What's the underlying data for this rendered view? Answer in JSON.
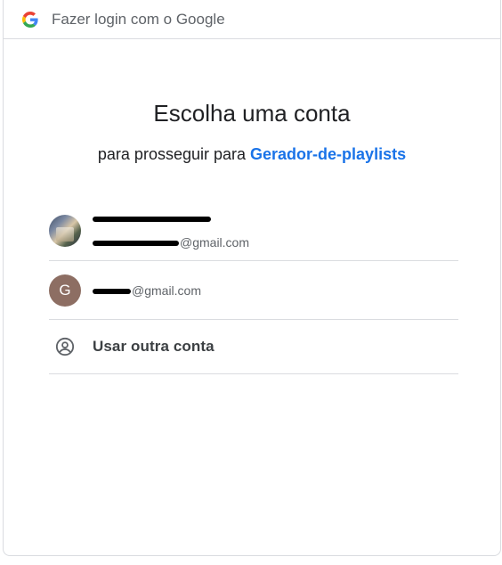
{
  "header": {
    "title": "Fazer login com o Google",
    "logo_icon": "google-g-icon"
  },
  "heading": "Escolha uma conta",
  "subtitle": {
    "prefix": "para prosseguir para",
    "app_name": "Gerador-de-playlists"
  },
  "accounts": [
    {
      "avatar": "photo",
      "email_domain": "@gmail.com"
    },
    {
      "avatar_letter": "G",
      "avatar_color": "#8d6e63",
      "email_domain": "@gmail.com"
    }
  ],
  "other_account": {
    "label": "Usar outra conta",
    "icon": "account-circle-icon"
  },
  "colors": {
    "link": "#1a73e8",
    "divider": "#dadce0",
    "secondary_text": "#5f6368"
  }
}
